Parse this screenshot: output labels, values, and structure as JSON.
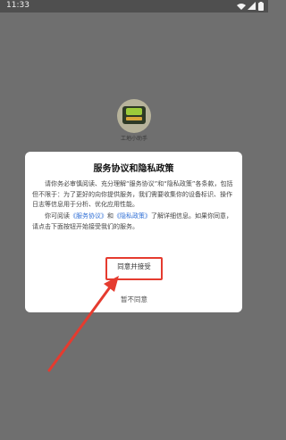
{
  "status_bar": {
    "time": "11:33",
    "icons": [
      "wifi-icon",
      "signal-icon",
      "battery-icon"
    ]
  },
  "splash": {
    "logo_icon": "app-logo-icon",
    "app_name": "工地小助手"
  },
  "dialog": {
    "title": "服务协议和隐私政策",
    "paragraph1": "请你务必审慎阅读、充分理解“服务协议”和“隐私政策”各条款，包括但不限于：为了更好的向你提供服务，我们需要收集你的设备标识、操作日志等信息用于分析、优化应用性能。",
    "p2_before": "你可阅读",
    "service_link": "《服务协议》",
    "p2_middle": "和",
    "privacy_link": "《隐私政策》",
    "p2_after": "了解详细信息。如果你同意，请点击下面按钮开始接受我们的服务。",
    "agree_button": "同意并接受",
    "disagree_button": "暂不同意"
  },
  "colors": {
    "overlay": "#6f6f6f",
    "dialog_bg": "#ffffff",
    "link": "#2f6fd6",
    "highlight": "#e53b2f"
  }
}
